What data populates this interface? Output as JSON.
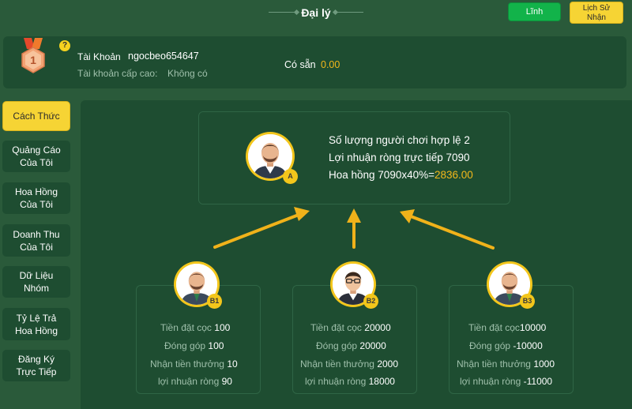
{
  "header": {
    "title": "Đại lý",
    "claim_label": "Lĩnh",
    "history_label_line1": "Lịch Sử",
    "history_label_line2": "Nhận"
  },
  "account": {
    "medal_number": "1",
    "help_symbol": "?",
    "account_label": "Tài Khoản",
    "account_name": "ngocbeo654647",
    "parent_label": "Tài khoản cấp cao:",
    "parent_value": "Không có",
    "available_label": "Có sẵn",
    "available_value": "0.00"
  },
  "sidebar": {
    "items": [
      {
        "line1": "Cách Thức",
        "line2": ""
      },
      {
        "line1": "Quảng Cáo",
        "line2": "Của Tôi"
      },
      {
        "line1": "Hoa Hồng",
        "line2": "Của Tôi"
      },
      {
        "line1": "Doanh Thu",
        "line2": "Của Tôi"
      },
      {
        "line1": "Dữ Liệu",
        "line2": "Nhóm"
      },
      {
        "line1": "Tỷ Lệ Trả",
        "line2": "Hoa Hồng"
      },
      {
        "line1": "Đăng Ký",
        "line2": "Trực Tiếp"
      }
    ]
  },
  "agent": {
    "badge": "A",
    "line1": "Số lượng người chơi hợp lệ 2",
    "line2": "Lợi nhuận ròng trực tiếp 7090",
    "line3_prefix": "Hoa hồng 7090x40%=",
    "line3_value": "2836.00"
  },
  "players": [
    {
      "badge": "B1",
      "deposit_label": "Tiền đặt cọc",
      "deposit": "100",
      "contrib_label": "Đóng góp",
      "contrib": "100",
      "bonus_label": "Nhận tiền thưởng",
      "bonus": "10",
      "profit_label": "lợi nhuận ròng",
      "profit": "90"
    },
    {
      "badge": "B2",
      "deposit_label": "Tiền đặt cọc",
      "deposit": "20000",
      "contrib_label": "Đóng góp",
      "contrib": "20000",
      "bonus_label": "Nhận tiền thưởng",
      "bonus": "2000",
      "profit_label": "lợi nhuận ròng",
      "profit": "18000"
    },
    {
      "badge": "B3",
      "deposit_label": "Tiền đặt cọc",
      "deposit": "10000",
      "contrib_label": "Đóng góp",
      "contrib": "-10000",
      "bonus_label": "Nhận tiền thưởng",
      "bonus": "1000",
      "profit_label": "lợi nhuận ròng",
      "profit": "-11000"
    }
  ],
  "colors": {
    "background": "#2a5a3a",
    "panel": "#1e4d31",
    "accent_yellow": "#f6d434",
    "accent_green": "#12b34a",
    "highlight": "#f3b81b",
    "arrow": "#f0b21a"
  },
  "icons": {
    "medal": "medal-icon",
    "help": "help-icon",
    "avatar": "avatar-icon"
  }
}
